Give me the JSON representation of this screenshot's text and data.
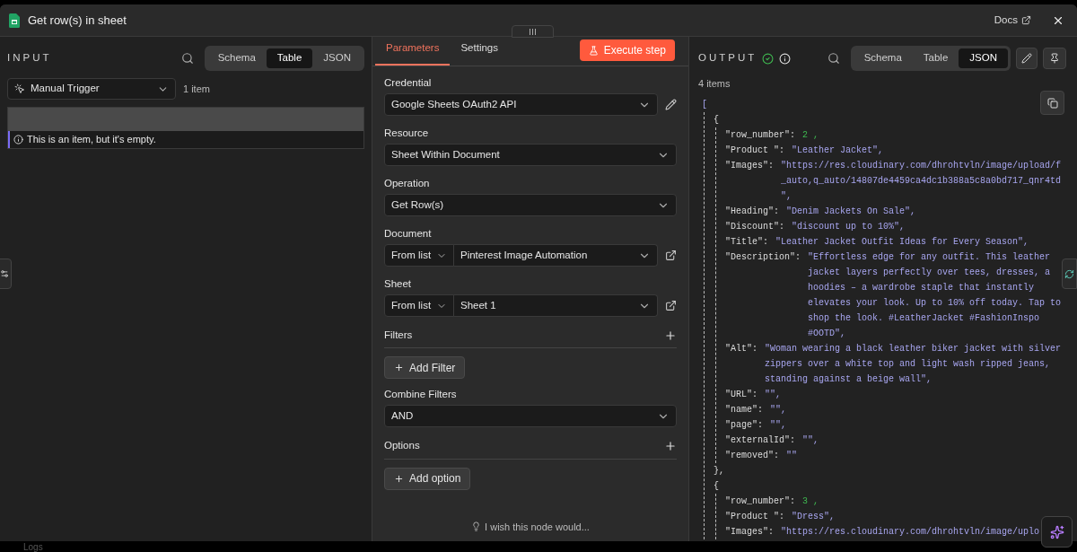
{
  "window": {
    "title": "Get row(s) in sheet",
    "docs_link": "Docs"
  },
  "input": {
    "heading": "INPUT",
    "views": [
      {
        "label": "Schema",
        "selected": false
      },
      {
        "label": "Table",
        "selected": true
      },
      {
        "label": "JSON",
        "selected": false
      }
    ],
    "source": "Manual Trigger",
    "count": "1 item",
    "empty_message": "This is an item, but it's empty."
  },
  "parameters": {
    "tabs": [
      {
        "label": "Parameters",
        "selected": true
      },
      {
        "label": "Settings",
        "selected": false
      }
    ],
    "execute_button": "Execute step",
    "fields": [
      {
        "kind": "credential",
        "label": "Credential",
        "value": "Google Sheets OAuth2 API"
      },
      {
        "kind": "select",
        "label": "Resource",
        "value": "Sheet Within Document"
      },
      {
        "kind": "select",
        "label": "Operation",
        "value": "Get Row(s)"
      },
      {
        "kind": "locator",
        "label": "Document",
        "mode": "From list",
        "value": "Pinterest Image Automation"
      },
      {
        "kind": "locator",
        "label": "Sheet",
        "mode": "From list",
        "value": "Sheet 1"
      },
      {
        "kind": "collection",
        "label": "Filters",
        "button": "Add Filter"
      },
      {
        "kind": "select",
        "label": "Combine Filters",
        "value": "AND"
      },
      {
        "kind": "collection",
        "label": "Options",
        "button": "Add option"
      }
    ],
    "feedback": "I wish this node would..."
  },
  "output": {
    "heading": "OUTPUT",
    "views": [
      {
        "label": "Schema",
        "selected": false
      },
      {
        "label": "Table",
        "selected": false
      },
      {
        "label": "JSON",
        "selected": true
      }
    ],
    "count": "4 items",
    "json_view": {
      "open": "[",
      "items": [
        {
          "open": "{",
          "close": "},",
          "fields": [
            {
              "key": "\"row_number\":",
              "kind": "number",
              "lines": [
                "2 ,"
              ]
            },
            {
              "key": "\"Product \":",
              "kind": "string",
              "lines": [
                "\"Leather Jacket\","
              ]
            },
            {
              "key": "\"Images\":",
              "kind": "string",
              "lines": [
                "\"https://res.cloudinary.com/dhrohtvln/image/upload/f",
                "_auto,q_auto/14807de4459ca4dc1b388a5c8a0bd717_qnr4td",
                "\","
              ]
            },
            {
              "key": "\"Heading\":",
              "kind": "string",
              "lines": [
                "\"Denim Jackets On Sale\","
              ]
            },
            {
              "key": "\"Discount\":",
              "kind": "string",
              "lines": [
                "\"discount up to 10%\","
              ]
            },
            {
              "key": "\"Title\":",
              "kind": "string",
              "lines": [
                "\"Leather Jacket Outfit Ideas for Every Season\","
              ]
            },
            {
              "key": "\"Description\":",
              "kind": "string",
              "lines": [
                "\"Effortless edge for any outfit. This leather",
                "jacket layers perfectly over tees, dresses, a",
                "hoodies – a wardrobe staple that instantly",
                "elevates your look. Up to 10% off today. Tap to",
                "shop the look. #LeatherJacket #FashionInspo",
                "#OOTD\","
              ]
            },
            {
              "key": "\"Alt\":",
              "kind": "string",
              "lines": [
                "\"Woman wearing a black leather biker jacket with silver",
                "zippers over a white top and light wash ripped jeans,",
                "standing against a beige wall\","
              ]
            },
            {
              "key": "\"URL\":",
              "kind": "string",
              "lines": [
                "\"\","
              ]
            },
            {
              "key": "\"name\":",
              "kind": "string",
              "lines": [
                "\"\","
              ]
            },
            {
              "key": "\"page\":",
              "kind": "string",
              "lines": [
                "\"\","
              ]
            },
            {
              "key": "\"externalId\":",
              "kind": "string",
              "lines": [
                "\"\","
              ]
            },
            {
              "key": "\"removed\":",
              "kind": "string",
              "lines": [
                "\"\""
              ]
            }
          ]
        },
        {
          "open": "{",
          "fields": [
            {
              "key": "\"row_number\":",
              "kind": "number",
              "lines": [
                "3 ,"
              ]
            },
            {
              "key": "\"Product \":",
              "kind": "string",
              "lines": [
                "\"Dress\","
              ]
            },
            {
              "key": "\"Images\":",
              "kind": "string",
              "lines": [
                "\"https://res.cloudinary.com/dhrohtvln/image/uplo"
              ]
            }
          ]
        }
      ]
    }
  },
  "bottom_bar": {
    "label": "Logs"
  }
}
